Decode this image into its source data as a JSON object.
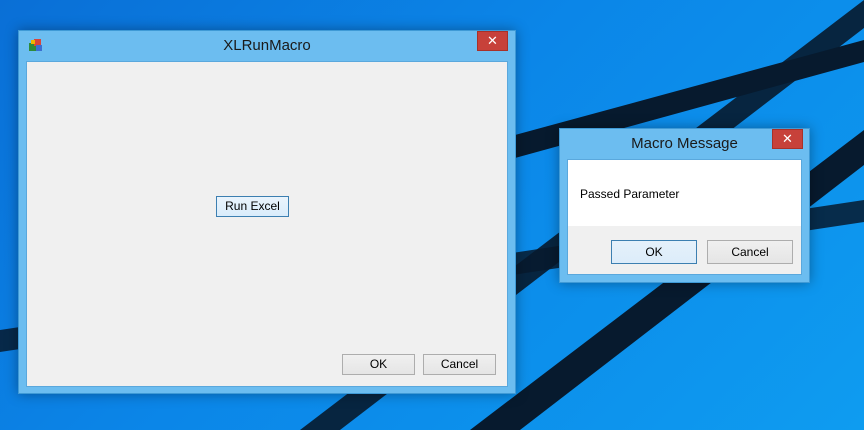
{
  "desktop": {
    "background_color": "#0b86e8",
    "line_color": "#071a2e"
  },
  "main_window": {
    "title": "XLRunMacro",
    "close_symbol": "✕",
    "icon": "excel-app-icon",
    "run_button_label": "Run Excel",
    "ok_label": "OK",
    "cancel_label": "Cancel"
  },
  "message_box": {
    "title": "Macro Message",
    "close_symbol": "✕",
    "message": "Passed Parameter",
    "ok_label": "OK",
    "cancel_label": "Cancel"
  },
  "colors": {
    "title_bar": "#6cbdf0",
    "close_button": "#c7413a",
    "client_area": "#f0f0f0"
  }
}
